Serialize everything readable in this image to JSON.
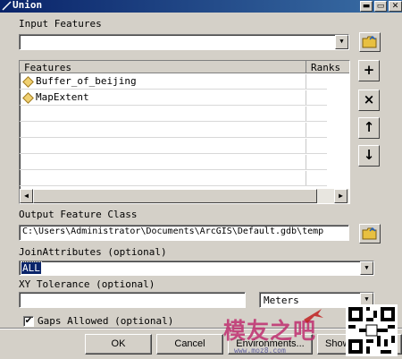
{
  "window": {
    "title": "Union",
    "controls": {
      "minimize": "▬",
      "maximize": "▭",
      "close": "✕"
    }
  },
  "input_features": {
    "label": "Input Features",
    "value": "",
    "columns": [
      "Features",
      "Ranks"
    ],
    "rows": [
      {
        "feature": "Buffer_of_beijing",
        "rank": ""
      },
      {
        "feature": "MapExtent",
        "rank": ""
      }
    ]
  },
  "side_buttons": {
    "add": "+",
    "remove": "×",
    "up": "↑",
    "down": "↓"
  },
  "output_feature_class": {
    "label": "Output Feature Class",
    "value": "C:\\Users\\Administrator\\Documents\\ArcGIS\\Default.gdb\\temp"
  },
  "join_attributes": {
    "label": "JoinAttributes (optional)",
    "value": "ALL"
  },
  "xy_tolerance": {
    "label": "XY Tolerance (optional)",
    "value": "",
    "unit": "Meters"
  },
  "gaps_allowed": {
    "label": "Gaps Allowed (optional)",
    "checked": true
  },
  "buttons": {
    "ok": "OK",
    "cancel": "Cancel",
    "environments": "Environments...",
    "show_help": "Show"
  },
  "watermark": {
    "text": "模友之吧",
    "url": "www.moz8.com"
  },
  "colors": {
    "titlebar": "#0a246a",
    "face": "#d4d0c8",
    "selection": "#0a246a",
    "folder": "#e8c040"
  }
}
